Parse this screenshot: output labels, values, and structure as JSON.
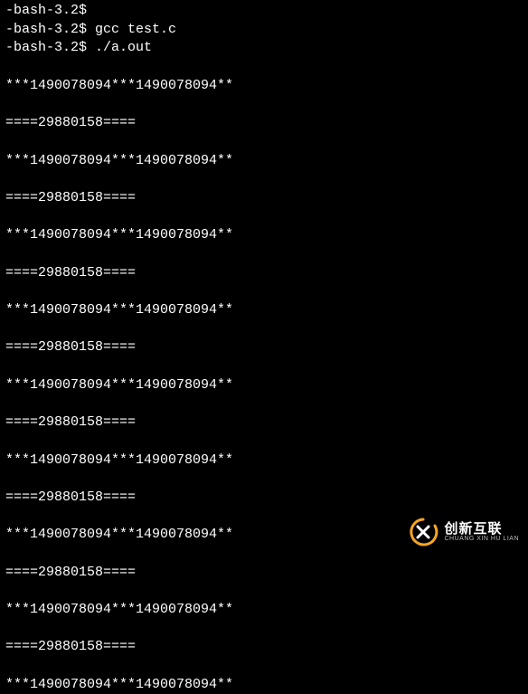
{
  "terminal": {
    "lines": [
      "-bash-3.2$",
      "-bash-3.2$ gcc test.c",
      "-bash-3.2$ ./a.out",
      "",
      "***1490078094***1490078094**",
      "",
      "====29880158====",
      "",
      "***1490078094***1490078094**",
      "",
      "====29880158====",
      "",
      "***1490078094***1490078094**",
      "",
      "====29880158====",
      "",
      "***1490078094***1490078094**",
      "",
      "====29880158====",
      "",
      "***1490078094***1490078094**",
      "",
      "====29880158====",
      "",
      "***1490078094***1490078094**",
      "",
      "====29880158====",
      "",
      "***1490078094***1490078094**",
      "",
      "====29880158====",
      "",
      "***1490078094***1490078094**",
      "",
      "====29880158====",
      "",
      "***1490078094***1490078094**"
    ]
  },
  "watermark": {
    "cn": "创新互联",
    "en": "CHUANG XIN HU LIAN"
  }
}
